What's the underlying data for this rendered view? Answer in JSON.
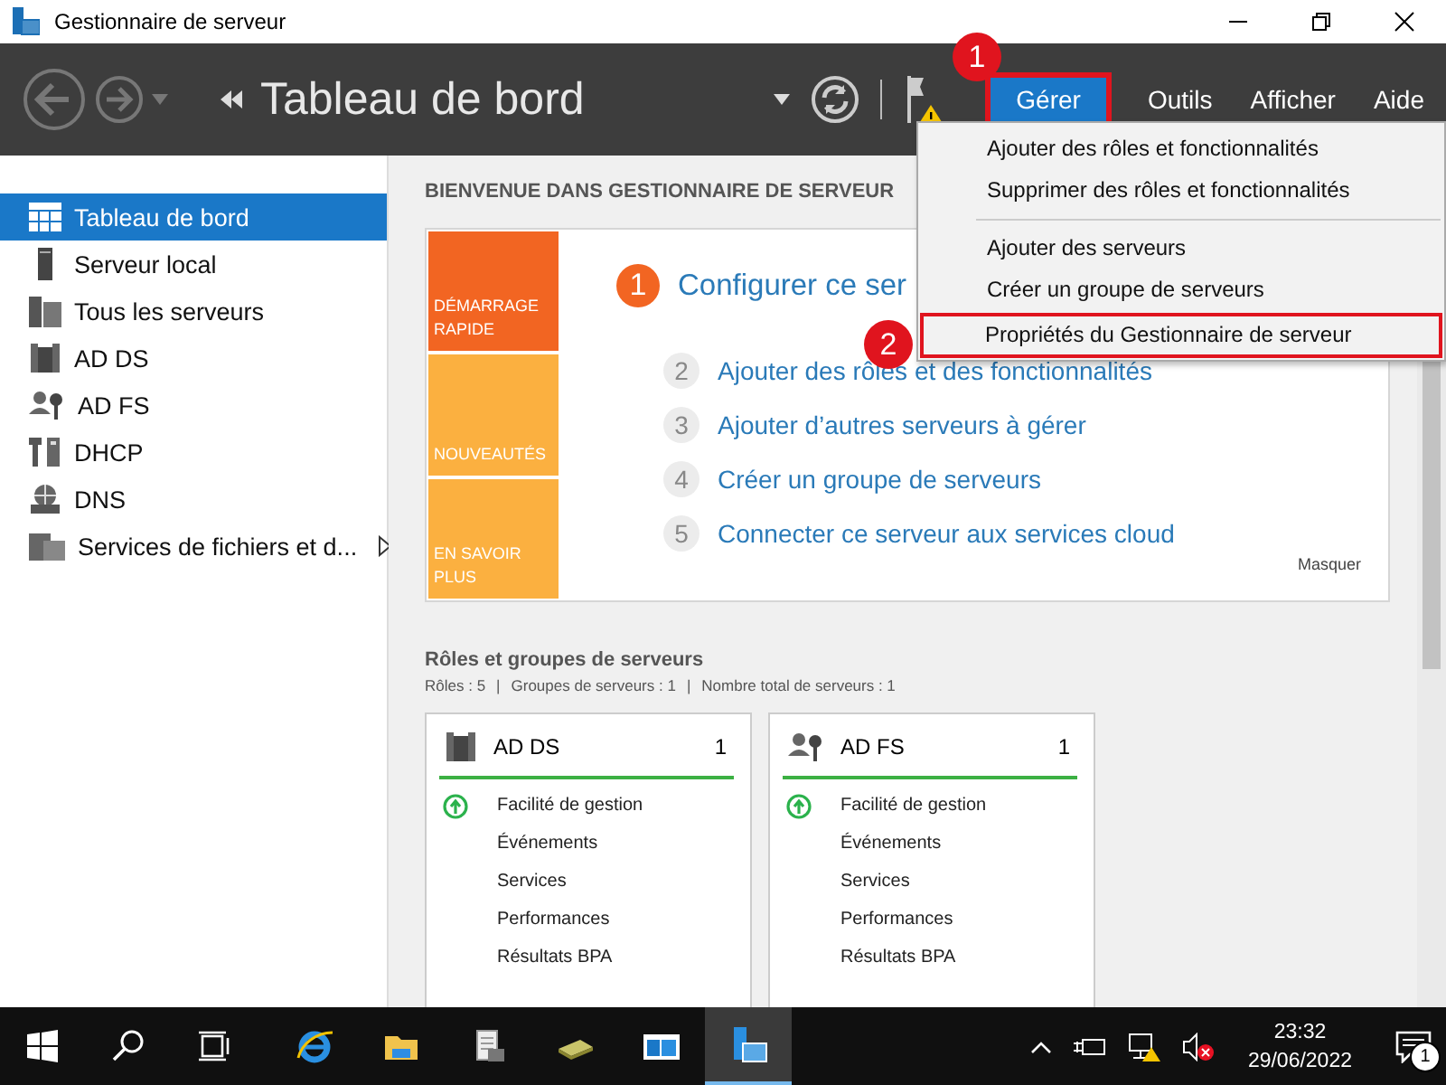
{
  "window": {
    "title": "Gestionnaire de serveur"
  },
  "toolbar": {
    "title": "Tableau de bord",
    "menus": [
      {
        "label": "Gérer",
        "selected": true
      },
      {
        "label": "Outils",
        "selected": false
      },
      {
        "label": "Afficher",
        "selected": false
      },
      {
        "label": "Aide",
        "selected": false
      }
    ]
  },
  "callouts": [
    "1",
    "2"
  ],
  "manage_menu": {
    "groups": [
      [
        {
          "label": "Ajouter des rôles et fonctionnalités",
          "highlighted": false
        },
        {
          "label": "Supprimer des rôles et fonctionnalités",
          "highlighted": false
        }
      ],
      [
        {
          "label": "Ajouter des serveurs",
          "highlighted": false
        },
        {
          "label": "Créer un groupe de serveurs",
          "highlighted": false
        },
        {
          "label": "Propriétés du Gestionnaire de serveur",
          "highlighted": true
        }
      ]
    ]
  },
  "sidebar": {
    "items": [
      {
        "label": "Tableau de bord",
        "kind": "dashboard",
        "selected": true,
        "has_submenu": false
      },
      {
        "label": "Serveur local",
        "kind": "server",
        "selected": false,
        "has_submenu": false
      },
      {
        "label": "Tous les serveurs",
        "kind": "servers",
        "selected": false,
        "has_submenu": false
      },
      {
        "label": "AD DS",
        "kind": "adds",
        "selected": false,
        "has_submenu": false
      },
      {
        "label": "AD FS",
        "kind": "adfs",
        "selected": false,
        "has_submenu": false
      },
      {
        "label": "DHCP",
        "kind": "dhcp",
        "selected": false,
        "has_submenu": false
      },
      {
        "label": "DNS",
        "kind": "dns",
        "selected": false,
        "has_submenu": false
      },
      {
        "label": "Services de fichiers et d...",
        "kind": "files",
        "selected": false,
        "has_submenu": true
      }
    ]
  },
  "welcome": {
    "heading": "BIENVENUE DANS GESTIONNAIRE DE SERVEUR",
    "tiles": [
      {
        "label": "DÉMARRAGE RAPIDE",
        "color": "#f26522"
      },
      {
        "label": "NOUVEAUTÉS",
        "color": "#fbb040"
      },
      {
        "label": "EN SAVOIR PLUS",
        "color": "#fbb040"
      }
    ],
    "main_step": {
      "number": "1",
      "text": "Configurer ce ser"
    },
    "steps": [
      {
        "number": "2",
        "text": "Ajouter des rôles et des fonctionnalités"
      },
      {
        "number": "3",
        "text": "Ajouter d’autres serveurs à gérer"
      },
      {
        "number": "4",
        "text": "Créer un groupe de serveurs"
      },
      {
        "number": "5",
        "text": "Connecter ce serveur aux services cloud"
      }
    ],
    "hide": "Masquer"
  },
  "roles": {
    "title": "Rôles et groupes de serveurs",
    "summary": [
      "Rôles : 5",
      "|",
      "Groupes de serveurs : 1",
      "|",
      "Nombre total de serveurs : 1"
    ],
    "cards": [
      {
        "name": "AD DS",
        "kind": "adds",
        "count": "1",
        "items": [
          {
            "label": "Facilité de gestion",
            "ok": true
          },
          {
            "label": "Événements",
            "ok": false
          },
          {
            "label": "Services",
            "ok": false
          },
          {
            "label": "Performances",
            "ok": false
          },
          {
            "label": "Résultats BPA",
            "ok": false
          }
        ]
      },
      {
        "name": "AD FS",
        "kind": "adfs",
        "count": "1",
        "items": [
          {
            "label": "Facilité de gestion",
            "ok": true
          },
          {
            "label": "Événements",
            "ok": false
          },
          {
            "label": "Services",
            "ok": false
          },
          {
            "label": "Performances",
            "ok": false
          },
          {
            "label": "Résultats BPA",
            "ok": false
          }
        ]
      }
    ]
  },
  "taskbar": {
    "time": "23:32",
    "date": "29/06/2022",
    "notifications": "1"
  }
}
